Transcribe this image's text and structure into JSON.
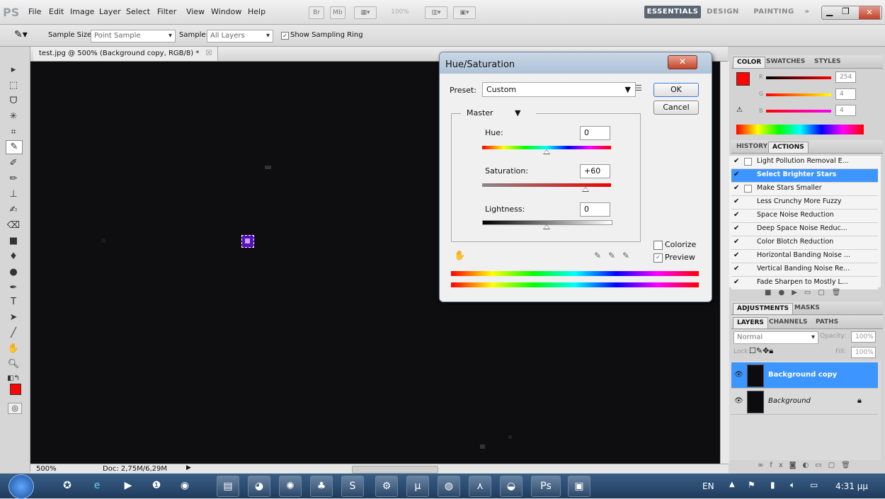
{
  "menubar": {
    "logo": "PS",
    "items": [
      "File",
      "Edit",
      "Image",
      "Layer",
      "Select",
      "Filter",
      "View",
      "Window",
      "Help"
    ],
    "zoom_display": "100%",
    "workspaces": [
      "ESSENTIALS",
      "DESIGN",
      "PAINTING"
    ],
    "more": "»"
  },
  "options": {
    "sample_size_label": "Sample Size:",
    "sample_size_value": "Point Sample",
    "sample_label": "Sample:",
    "sample_value": "All Layers",
    "show_ring_label": "Show Sampling Ring"
  },
  "document": {
    "tab_title": "test.jpg @ 500% (Background copy, RGB/8) *",
    "zoom": "500%",
    "doc_info": "Doc: 2,75M/6,29M"
  },
  "dialog": {
    "title": "Hue/Saturation",
    "preset_label": "Preset:",
    "preset_value": "Custom",
    "ok": "OK",
    "cancel": "Cancel",
    "channel": "Master",
    "hue_label": "Hue:",
    "hue_value": "0",
    "hue_level": 0.5,
    "saturation_label": "Saturation:",
    "saturation_value": "+60",
    "saturation_level": 0.8,
    "lightness_label": "Lightness:",
    "lightness_value": "0",
    "lightness_level": 0.5,
    "colorize_label": "Colorize",
    "colorize_checked": false,
    "preview_label": "Preview",
    "preview_checked": true
  },
  "color_panel": {
    "tabs": [
      "COLOR",
      "SWATCHES",
      "STYLES"
    ],
    "r_label": "R",
    "r_value": "254",
    "g_label": "G",
    "g_value": "4",
    "b_label": "B",
    "b_value": "4",
    "foreground": "#fe0404"
  },
  "history_panel": {
    "tabs": [
      "HISTORY",
      "ACTIONS"
    ],
    "actions": [
      {
        "label": "Light Pollution Removal E...",
        "selected": false
      },
      {
        "label": "Select Brighter Stars",
        "selected": true
      },
      {
        "label": "Make Stars Smaller",
        "selected": false
      },
      {
        "label": "Less Crunchy More Fuzzy",
        "selected": false
      },
      {
        "label": "Space Noise Reduction",
        "selected": false
      },
      {
        "label": "Deep Space Noise Reduc...",
        "selected": false
      },
      {
        "label": "Color Blotch Reduction",
        "selected": false
      },
      {
        "label": "Horizontal Banding Noise ...",
        "selected": false
      },
      {
        "label": "Vertical Banding Noise Re...",
        "selected": false
      },
      {
        "label": "Fade Sharpen to Mostly L...",
        "selected": false
      }
    ]
  },
  "adjust_panel": {
    "tabs": [
      "ADJUSTMENTS",
      "MASKS"
    ]
  },
  "layers_panel": {
    "tabs": [
      "LAYERS",
      "CHANNELS",
      "PATHS"
    ],
    "blend_mode": "Normal",
    "opacity_label": "Opacity:",
    "opacity_value": "100%",
    "lock_label": "Lock:",
    "fill_label": "Fill:",
    "fill_value": "100%",
    "layers": [
      {
        "name": "Background copy",
        "selected": true
      },
      {
        "name": "Background",
        "selected": false
      }
    ]
  },
  "taskbar": {
    "lang": "EN",
    "time": "4:31 μμ"
  },
  "colors": {
    "accent": "#3d95ff",
    "selected_row": "#3d95ff"
  }
}
